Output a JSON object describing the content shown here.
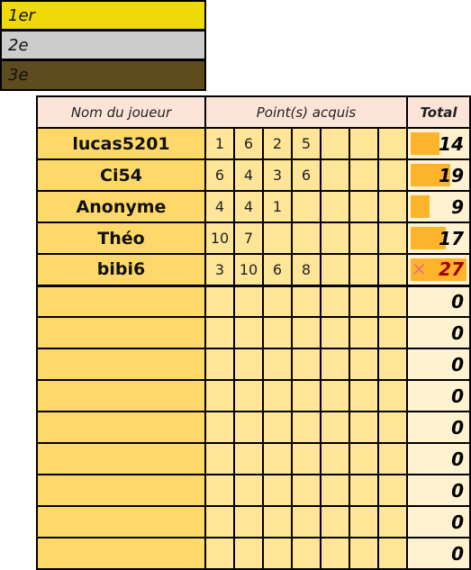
{
  "legend": [
    {
      "label": "1er",
      "color": "#efd907"
    },
    {
      "label": "2e",
      "color": "#cccccc"
    },
    {
      "label": "3e",
      "color": "#5f4c1e"
    }
  ],
  "header": {
    "name": "Nom du joueur",
    "points": "Point(s) acquis",
    "total": "Total"
  },
  "max_total": 27,
  "players": [
    {
      "name": "lucas5201",
      "points": [
        "1",
        "6",
        "2",
        "5",
        "",
        "",
        ""
      ],
      "total": "14",
      "bar": 14,
      "eliminated": false
    },
    {
      "name": "Ci54",
      "points": [
        "6",
        "4",
        "3",
        "6",
        "",
        "",
        ""
      ],
      "total": "19",
      "bar": 19,
      "eliminated": false
    },
    {
      "name": "Anonyme",
      "points": [
        "4",
        "4",
        "1",
        "",
        "",
        "",
        ""
      ],
      "total": "9",
      "bar": 9,
      "eliminated": false
    },
    {
      "name": "Théo",
      "points": [
        "10",
        "7",
        "",
        "",
        "",
        "",
        ""
      ],
      "total": "17",
      "bar": 17,
      "eliminated": false
    },
    {
      "name": "bibi6",
      "points": [
        "3",
        "10",
        "6",
        "8",
        "",
        "",
        ""
      ],
      "total": "27",
      "bar": 27,
      "eliminated": true,
      "icon": "✕"
    }
  ],
  "empty_rows": 9,
  "empty_total": "0"
}
